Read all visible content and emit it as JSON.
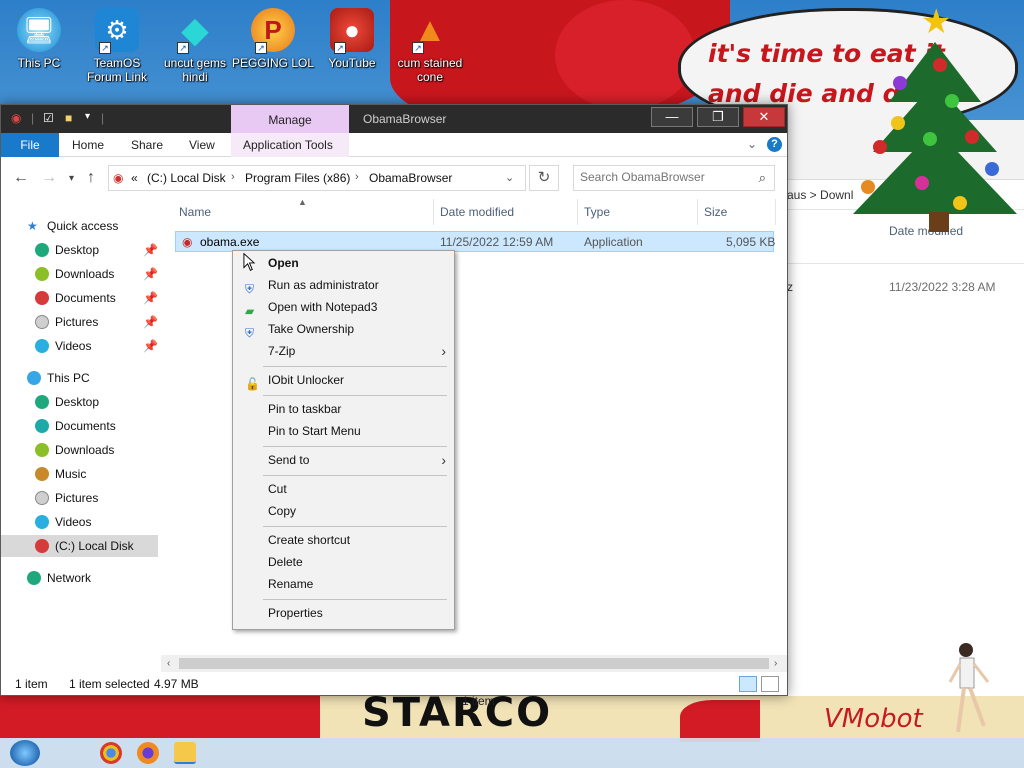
{
  "desktop": {
    "icons": [
      {
        "label": "This PC"
      },
      {
        "label": "TeamOS Forum Link"
      },
      {
        "label": "uncut gems hindi"
      },
      {
        "label": "PEGGING LOL"
      },
      {
        "label": "YouTube"
      },
      {
        "label": "cum stained cone"
      }
    ],
    "speech_bubble": "it's time to eat it\nand die and d",
    "wall_text_left": "STARCO",
    "wall_text_right": "VMobot",
    "bg_window": {
      "path": "aus  >  Downl",
      "col_date": "Date modified",
      "row_name": "z",
      "row_date": "11/23/2022 3:28 AM",
      "status": "1 item"
    }
  },
  "window": {
    "title": "ObamaBrowser",
    "manage_label": "Manage",
    "ribbon_tabs": [
      "File",
      "Home",
      "Share",
      "View",
      "Application Tools"
    ],
    "address": {
      "prefix": "«",
      "segments": [
        "(C:) Local Disk",
        "Program Files (x86)",
        "ObamaBrowser"
      ]
    },
    "search_placeholder": "Search ObamaBrowser",
    "nav": {
      "quick_access": "Quick access",
      "quick_items": [
        "Desktop",
        "Downloads",
        "Documents",
        "Pictures",
        "Videos"
      ],
      "this_pc": "This PC",
      "pc_items": [
        "Desktop",
        "Documents",
        "Downloads",
        "Music",
        "Pictures",
        "Videos",
        "(C:) Local Disk"
      ],
      "network": "Network"
    },
    "columns": [
      "Name",
      "Date modified",
      "Type",
      "Size"
    ],
    "files": [
      {
        "name": "obama.exe",
        "date": "11/25/2022 12:59 AM",
        "type": "Application",
        "size": "5,095 KB"
      }
    ],
    "status": {
      "count": "1 item",
      "selected": "1 item selected",
      "size": "4.97 MB"
    }
  },
  "context_menu": {
    "open": "Open",
    "run_admin": "Run as administrator",
    "open_notepad": "Open with Notepad3",
    "take_ownership": "Take Ownership",
    "zip": "7-Zip",
    "iobit": "IObit Unlocker",
    "pin_taskbar": "Pin to taskbar",
    "pin_start": "Pin to Start Menu",
    "send_to": "Send to",
    "cut": "Cut",
    "copy": "Copy",
    "create_shortcut": "Create shortcut",
    "delete": "Delete",
    "rename": "Rename",
    "properties": "Properties"
  },
  "colors": {
    "accent": "#1979ca",
    "selection": "#cce8ff",
    "close_button": "#c7383a",
    "manage_tab": "#e8c9f3"
  }
}
